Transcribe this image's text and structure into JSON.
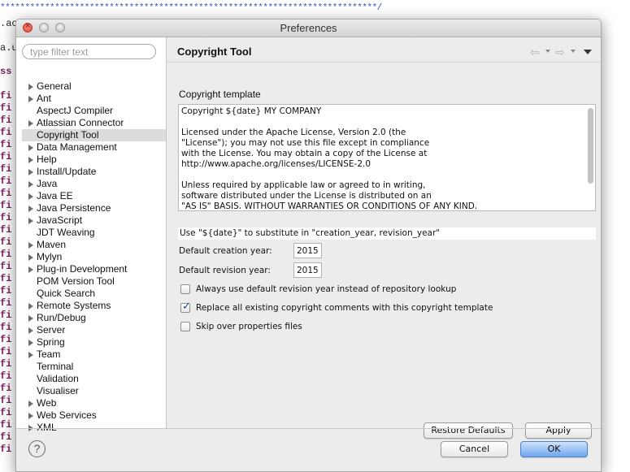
{
  "background": {
    "stars": "****************************************************************************/",
    "lines": [
      {
        "text": ".ac",
        "type": "plain"
      },
      {
        "text": "a.u",
        "type": "plain"
      },
      {
        "text": "ss",
        "type": "kw"
      },
      {
        "text": "fi",
        "type": "kw"
      }
    ]
  },
  "dialog": {
    "title": "Preferences",
    "filter_placeholder": "type filter text",
    "help_label": "?",
    "tree": [
      {
        "label": "General",
        "expandable": true
      },
      {
        "label": "Ant",
        "expandable": true
      },
      {
        "label": "AspectJ Compiler",
        "expandable": false
      },
      {
        "label": "Atlassian Connector",
        "expandable": true
      },
      {
        "label": "Copyright Tool",
        "expandable": false,
        "selected": true
      },
      {
        "label": "Data Management",
        "expandable": true
      },
      {
        "label": "Help",
        "expandable": true
      },
      {
        "label": "Install/Update",
        "expandable": true
      },
      {
        "label": "Java",
        "expandable": true
      },
      {
        "label": "Java EE",
        "expandable": true
      },
      {
        "label": "Java Persistence",
        "expandable": true
      },
      {
        "label": "JavaScript",
        "expandable": true
      },
      {
        "label": "JDT Weaving",
        "expandable": false
      },
      {
        "label": "Maven",
        "expandable": true
      },
      {
        "label": "Mylyn",
        "expandable": true
      },
      {
        "label": "Plug-in Development",
        "expandable": true
      },
      {
        "label": "POM Version Tool",
        "expandable": false
      },
      {
        "label": "Quick Search",
        "expandable": false
      },
      {
        "label": "Remote Systems",
        "expandable": true
      },
      {
        "label": "Run/Debug",
        "expandable": true
      },
      {
        "label": "Server",
        "expandable": true
      },
      {
        "label": "Spring",
        "expandable": true
      },
      {
        "label": "Team",
        "expandable": true
      },
      {
        "label": "Terminal",
        "expandable": false
      },
      {
        "label": "Validation",
        "expandable": false
      },
      {
        "label": "Visualiser",
        "expandable": false
      },
      {
        "label": "Web",
        "expandable": true
      },
      {
        "label": "Web Services",
        "expandable": true
      },
      {
        "label": "XML",
        "expandable": true
      }
    ]
  },
  "page": {
    "title": "Copyright Tool",
    "template_label": "Copyright template",
    "template_text": "Copyright ${date} MY COMPANY\n\nLicensed under the Apache License, Version 2.0 (the\n\"License\"); you may not use this file except in compliance\nwith the License. You may obtain a copy of the License at\nhttp://www.apache.org/licenses/LICENSE-2.0\n\nUnless required by applicable law or agreed to in writing,\nsoftware distributed under the License is distributed on an\n\"AS IS\" BASIS, WITHOUT WARRANTIES OR CONDITIONS OF ANY KIND,",
    "hint": "Use \"${date}\" to substitute in \"creation_year, revision_year\"",
    "creation_label": "Default creation year:",
    "creation_value": "2015",
    "revision_label": "Default revision year:",
    "revision_value": "2015",
    "checkboxes": [
      {
        "label": "Always use default revision year instead of repository lookup",
        "checked": false
      },
      {
        "label": "Replace all existing copyright comments with this copyright template",
        "checked": true
      },
      {
        "label": "Skip over properties files",
        "checked": false
      }
    ],
    "restore_defaults": "Restore Defaults",
    "apply": "Apply"
  },
  "footer": {
    "cancel": "Cancel",
    "ok": "OK"
  },
  "colors": {
    "accent": "#6fa6ef",
    "selection": "#dcdcdc"
  }
}
